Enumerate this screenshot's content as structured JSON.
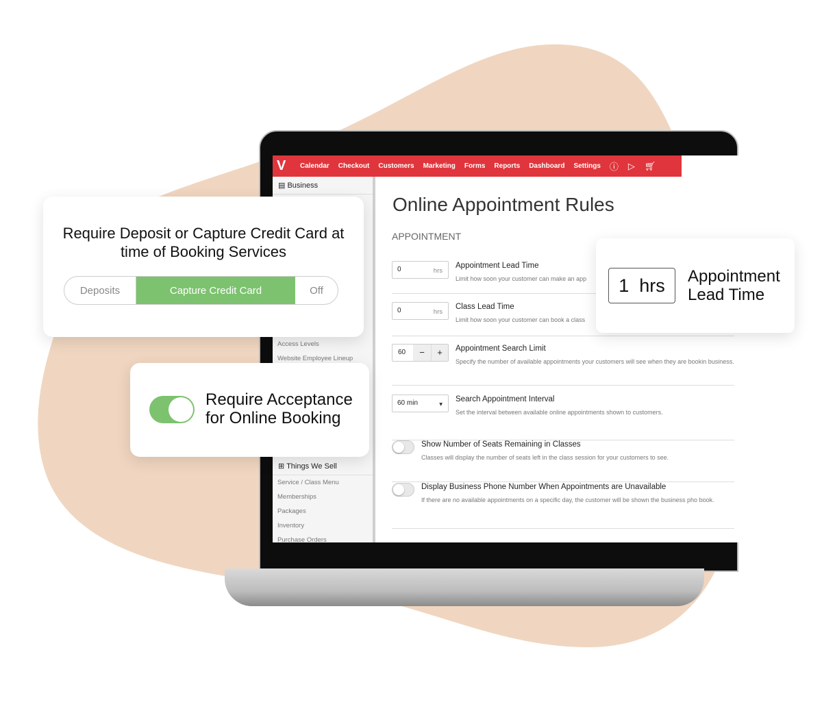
{
  "colors": {
    "brand_red": "#e0353c",
    "accent_green": "#7dc26f",
    "blob": "#f0d6c0"
  },
  "topnav": {
    "logo": "V",
    "items": [
      "Calendar",
      "Checkout",
      "Customers",
      "Marketing",
      "Forms",
      "Reports",
      "Dashboard",
      "Settings"
    ],
    "icons": [
      "help-icon",
      "play-icon",
      "cart-icon"
    ]
  },
  "sidebar": {
    "business_header": "Business",
    "business_items": [
      "Access Levels",
      "Website Employee Lineup"
    ],
    "sell_header": "Things We Sell",
    "sell_items": [
      "Service / Class Menu",
      "Memberships",
      "Packages",
      "Inventory",
      "Purchase Orders"
    ]
  },
  "main": {
    "title": "Online Appointment Rules",
    "section": "APPOINTMENT",
    "rows": [
      {
        "value": "0",
        "unit": "hrs",
        "title": "Appointment Lead Time",
        "desc": "Limit how soon your customer can make an app"
      },
      {
        "value": "0",
        "unit": "hrs",
        "title": "Class Lead Time",
        "desc": "Limit how soon your customer can book a class"
      },
      {
        "value": "60",
        "minus": "−",
        "plus": "+",
        "title": "Appointment Search Limit",
        "desc": "Specify the number of available appointments your customers will see when they are bookin business."
      },
      {
        "value": "60 min",
        "title": "Search Appointment Interval",
        "desc": "Set the interval between available online appointments shown to customers."
      },
      {
        "toggle": false,
        "title": "Show Number of Seats Remaining in Classes",
        "desc": "Classes will display the number of seats left in the class session for your customers to see."
      },
      {
        "toggle": false,
        "title": "Display Business Phone Number When Appointments are Unavailable",
        "desc": "If there are no available appointments on a specific day, the customer will be shown the business pho book."
      }
    ]
  },
  "card_deposit": {
    "title": "Require Deposit or Capture Credit Card at time of Booking Services",
    "options": [
      "Deposits",
      "Capture Credit Card",
      "Off"
    ],
    "selected": "Capture Credit Card"
  },
  "card_acceptance": {
    "title": "Require Acceptance for Online Booking",
    "toggle_on": true
  },
  "card_lead": {
    "value": "1  hrs",
    "label": "Appointment Lead Time"
  }
}
